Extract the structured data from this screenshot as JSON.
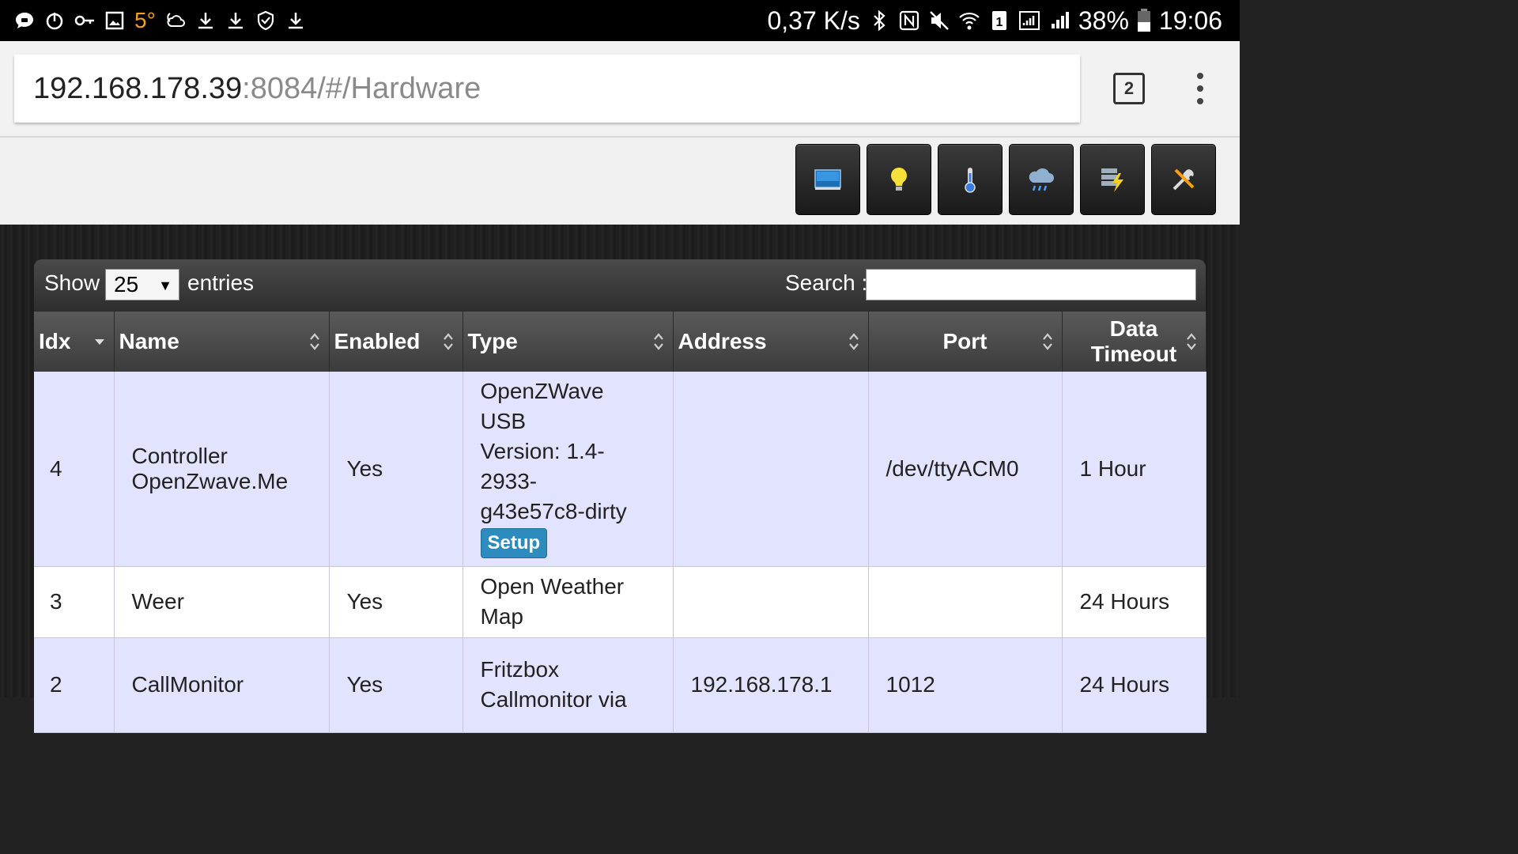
{
  "status_bar": {
    "left_icons": [
      "chat-icon",
      "power-icon",
      "key-icon",
      "image-icon",
      "temperature-text",
      "weather-icon",
      "download-icon",
      "download-icon",
      "shield-icon",
      "download-icon"
    ],
    "temperature": "5°",
    "net_speed": "0,37 K/s",
    "battery": "38%",
    "time": "19:06",
    "sim_slot": "1"
  },
  "browser": {
    "url_host": "192.168.178.39",
    "url_path": ":8084/#/Hardware",
    "tab_count": "2"
  },
  "toolbar": {
    "buttons": [
      "dashboard-icon",
      "light-bulb-icon",
      "thermometer-icon",
      "weather-rain-icon",
      "utility-icon",
      "tools-icon"
    ]
  },
  "table_controls": {
    "show_label": "Show",
    "page_size": "25",
    "entries_label": "entries",
    "search_label": "Search :"
  },
  "columns": [
    "Idx",
    "Name",
    "Enabled",
    "Type",
    "Address",
    "Port",
    "Data Timeout"
  ],
  "rows": [
    {
      "idx": "4",
      "name_lines": [
        "Controller",
        "OpenZwave.Me"
      ],
      "enabled": "Yes",
      "type_lines": [
        "OpenZWave",
        "USB",
        "Version: 1.4-",
        "2933-",
        "g43e57c8-dirty"
      ],
      "setup": "Setup",
      "address": "",
      "port": "/dev/ttyACM0",
      "timeout": "1 Hour"
    },
    {
      "idx": "3",
      "name_lines": [
        "Weer"
      ],
      "enabled": "Yes",
      "type_lines": [
        "Open Weather",
        "Map"
      ],
      "address": "",
      "port": "",
      "timeout": "24 Hours"
    },
    {
      "idx": "2",
      "name_lines": [
        "CallMonitor"
      ],
      "enabled": "Yes",
      "type_lines": [
        "Fritzbox",
        "Callmonitor via"
      ],
      "address": "192.168.178.1",
      "port": "1012",
      "timeout": "24 Hours"
    }
  ]
}
